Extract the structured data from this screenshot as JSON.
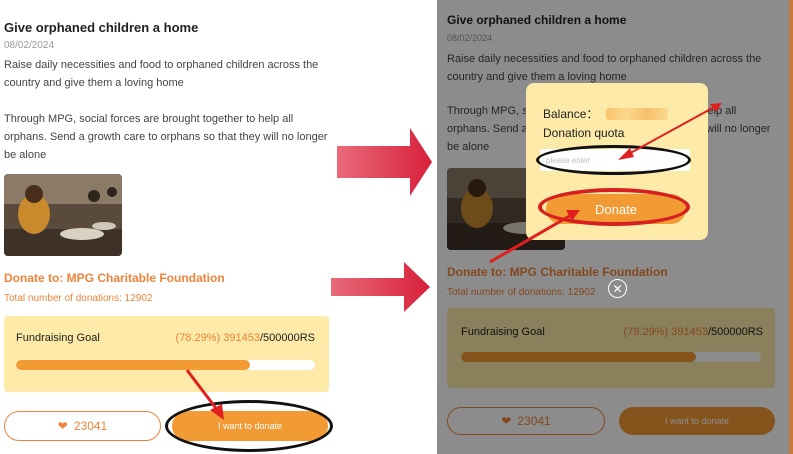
{
  "project": {
    "title": "Give orphaned children a home",
    "date": "08/02/2024",
    "paragraph1": "Raise daily necessities and food to orphaned children across the country and give them a loving home",
    "paragraph2": "Through MPG, social forces are brought together to help all orphans. Send a growth care to orphans so that they will no longer be alone",
    "donate_to": "Donate to: MPG Charitable Foundation",
    "total_donations": "Total number of donations: 12902"
  },
  "fundraising": {
    "label": "Fundraising Goal",
    "percent_text": "(78.29%) ",
    "raised": "391453",
    "target": "/500000RS",
    "progress_fraction": 0.7829
  },
  "actions": {
    "likes": "23041",
    "donate_label": "I want to donate"
  },
  "modal": {
    "balance_label": "Balance：",
    "quota_label": "Donation quota",
    "input_placeholder": "please enter",
    "donate_button": "Donate"
  },
  "icons": {
    "like": "heart-icon",
    "close": "close-circle-icon"
  },
  "colors": {
    "accent": "#f0833a",
    "progress": "#f29a33",
    "panel": "#fde9a8",
    "annotation_red": "#d62020"
  }
}
